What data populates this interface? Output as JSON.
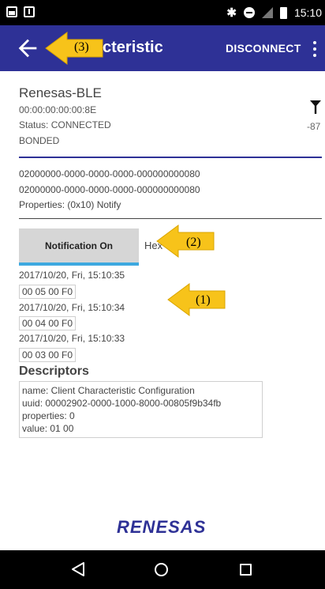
{
  "status_bar": {
    "left_icons": [
      "image-icon",
      "download-icon"
    ],
    "bluetooth_icon": "bluetooth-icon",
    "time": "15:10"
  },
  "app_bar": {
    "title": "cteristic",
    "disconnect_label": "DISCONNECT",
    "color": "#2e3196"
  },
  "device": {
    "name": "Renesas-BLE",
    "address": "00:00:00:00:00:8E",
    "status": "Status: CONNECTED",
    "bond_state": "BONDED",
    "rssi": "-87"
  },
  "characteristic": {
    "service_uuid": "02000000-0000-0000-0000-000000000080",
    "char_uuid": "02000000-0000-0000-0000-000000000080",
    "properties": "Properties: (0x10) Notify"
  },
  "notification": {
    "button_label": "Notification On",
    "format_label": "Hex",
    "accent_color": "#3da9e0"
  },
  "log": [
    {
      "time": "2017/10/20, Fri, 15:10:35",
      "value": "00 05 00 F0"
    },
    {
      "time": "2017/10/20, Fri, 15:10:34",
      "value": "00 04 00 F0"
    },
    {
      "time": "2017/10/20, Fri, 15:10:33",
      "value": "00 03 00 F0"
    }
  ],
  "descriptors": {
    "heading": "Descriptors",
    "items": [
      {
        "name": "name: Client Characteristic Configuration",
        "uuid": "uuid: 00002902-0000-1000-8000-00805f9b34fb",
        "properties": "properties: 0",
        "value": "value: 01 00"
      }
    ]
  },
  "callouts": [
    "(1)",
    "(2)",
    "(3)"
  ],
  "logo": "RENESAS"
}
